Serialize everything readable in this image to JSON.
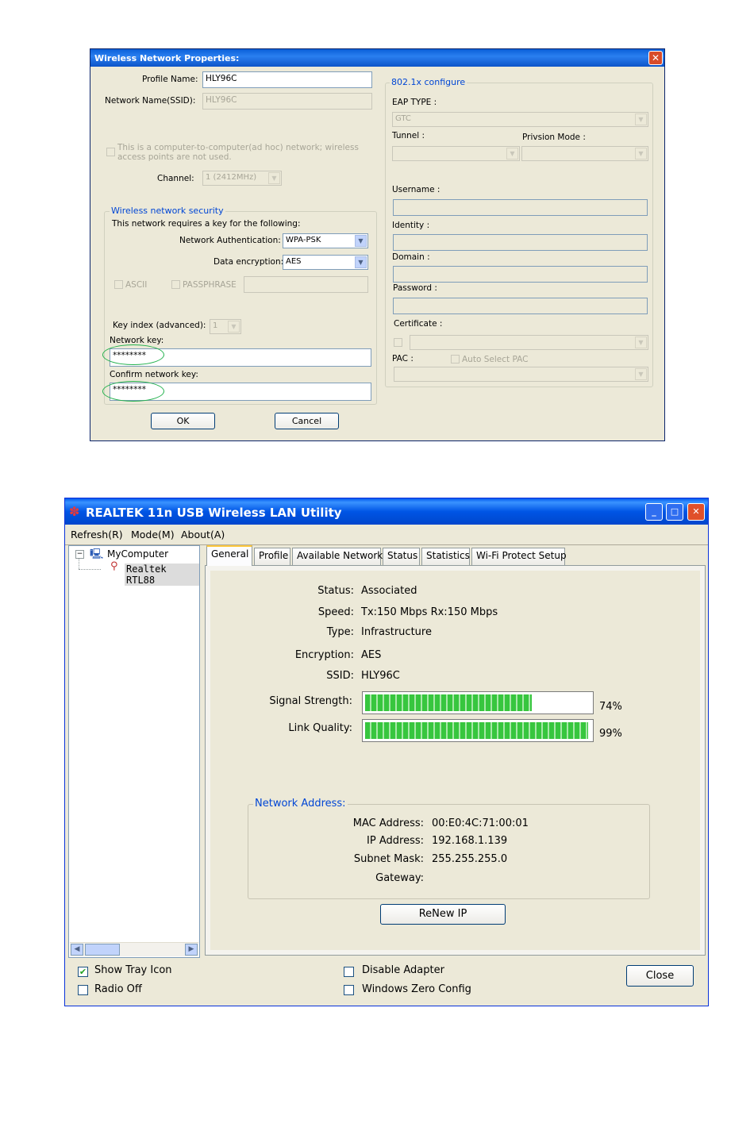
{
  "dialog": {
    "title": "Wireless Network Properties:",
    "profile_name_label": "Profile Name:",
    "profile_name_value": "HLY96C",
    "ssid_label": "Network Name(SSID):",
    "ssid_value": "HLY96C",
    "adhoc_label_line1": "This is a computer-to-computer(ad hoc) network; wireless",
    "adhoc_label_line2": "access points are not used.",
    "channel_label": "Channel:",
    "channel_value": "1  (2412MHz)",
    "security": {
      "legend": "Wireless network security",
      "intro": "This network requires a key for the following:",
      "auth_label": "Network Authentication:",
      "auth_value": "WPA-PSK",
      "enc_label": "Data encryption:",
      "enc_value": "AES",
      "ascii_label": "ASCII",
      "passphrase_label": "PASSPHRASE",
      "key_index_label": "Key index (advanced):",
      "key_index_value": "1",
      "network_key_label": "Network key:",
      "network_key_value": "********",
      "confirm_key_label": "Confirm network key:",
      "confirm_key_value": "********"
    },
    "eap": {
      "legend": "802.1x configure",
      "eap_type_label": "EAP TYPE :",
      "eap_type_value": "GTC",
      "tunnel_label": "Tunnel :",
      "provision_label": "Privsion Mode :",
      "username_label": "Username :",
      "identity_label": "Identity :",
      "domain_label": "Domain :",
      "password_label": "Password :",
      "certificate_label": "Certificate :",
      "pac_label": "PAC :",
      "auto_pac_label": "Auto Select PAC"
    },
    "ok_label": "OK",
    "cancel_label": "Cancel"
  },
  "utility": {
    "title": "REALTEK 11n USB Wireless LAN Utility",
    "menu": [
      "Refresh(R)",
      "Mode(M)",
      "About(A)"
    ],
    "tree": {
      "root": "MyComputer",
      "child": "Realtek RTL88"
    },
    "tabs": [
      "General",
      "Profile",
      "Available Network",
      "Status",
      "Statistics",
      "Wi-Fi Protect Setup"
    ],
    "general": {
      "status_label": "Status:",
      "status_value": "Associated",
      "speed_label": "Speed:",
      "speed_value": "Tx:150 Mbps Rx:150 Mbps",
      "type_label": "Type:",
      "type_value": "Infrastructure",
      "encryption_label": "Encryption:",
      "encryption_value": "AES",
      "ssid_label": "SSID:",
      "ssid_value": "HLY96C",
      "signal_label": "Signal Strength:",
      "signal_text": "74%",
      "signal_percent": 74,
      "link_label": "Link Quality:",
      "link_text": "99%",
      "link_percent": 99
    },
    "network_address": {
      "legend": "Network Address:",
      "mac_label": "MAC Address:",
      "mac_value": "00:E0:4C:71:00:01",
      "ip_label": "IP Address:",
      "ip_value": "192.168.1.139",
      "subnet_label": "Subnet Mask:",
      "subnet_value": "255.255.255.0",
      "gateway_label": "Gateway:",
      "gateway_value": ""
    },
    "renew_label": "ReNew IP",
    "show_tray_label": "Show Tray Icon",
    "radio_off_label": "Radio Off",
    "disable_adapter_label": "Disable Adapter",
    "wzc_label": "Windows Zero Config",
    "close_label": "Close"
  }
}
